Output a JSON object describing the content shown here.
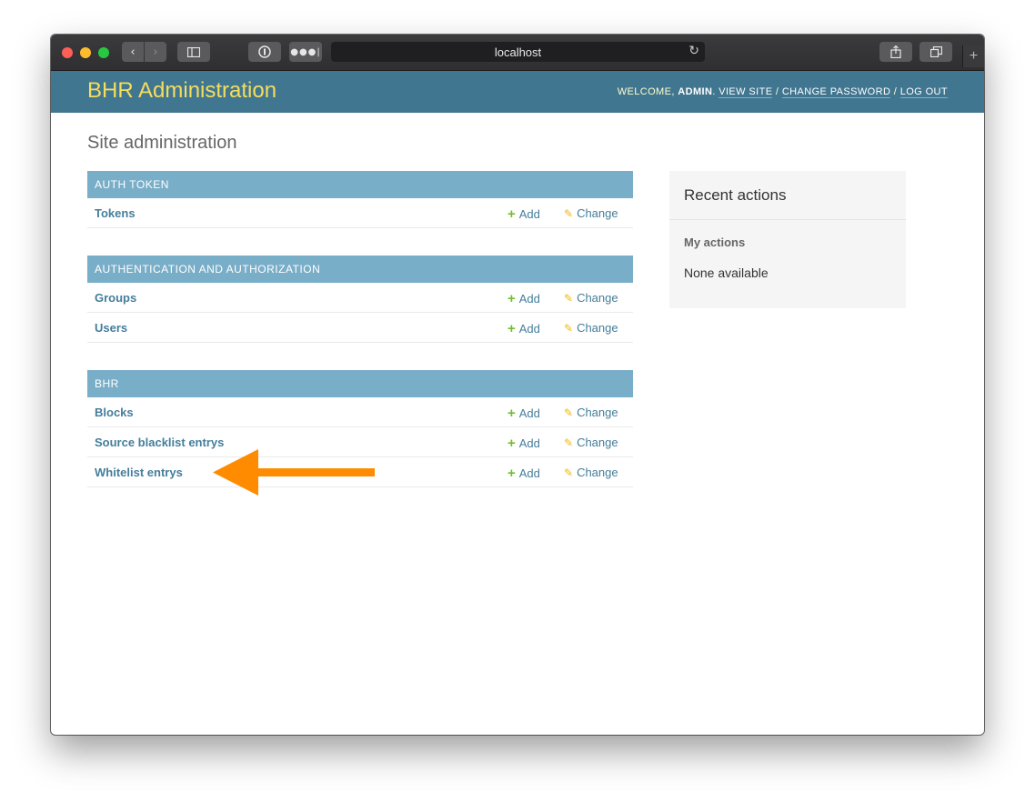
{
  "browser": {
    "url": "localhost"
  },
  "header": {
    "brand": "BHR Administration",
    "welcome_prefix": "Welcome, ",
    "username": "admin",
    "view_site": "View site",
    "change_password": "Change password",
    "log_out": "Log out"
  },
  "page": {
    "title": "Site administration"
  },
  "modules": [
    {
      "caption": "Auth Token",
      "models": [
        {
          "name": "Tokens",
          "add": "Add",
          "change": "Change"
        }
      ]
    },
    {
      "caption": "Authentication and Authorization",
      "models": [
        {
          "name": "Groups",
          "add": "Add",
          "change": "Change"
        },
        {
          "name": "Users",
          "add": "Add",
          "change": "Change"
        }
      ]
    },
    {
      "caption": "BHR",
      "models": [
        {
          "name": "Blocks",
          "add": "Add",
          "change": "Change"
        },
        {
          "name": "Source blacklist entrys",
          "add": "Add",
          "change": "Change"
        },
        {
          "name": "Whitelist entrys",
          "add": "Add",
          "change": "Change"
        }
      ]
    }
  ],
  "recent_actions": {
    "title": "Recent actions",
    "my_actions": "My actions",
    "none": "None available"
  },
  "colors": {
    "header_bg": "#417690",
    "brand": "#f5dd5d",
    "module_caption_bg": "#79aec8",
    "link": "#447e9b",
    "add_icon": "#70bf2b",
    "change_icon": "#efb80b",
    "annotation_arrow": "#ff8c00"
  },
  "icons": {
    "add": "plus-icon",
    "change": "pencil-icon",
    "annotation": "arrow-left-icon"
  }
}
